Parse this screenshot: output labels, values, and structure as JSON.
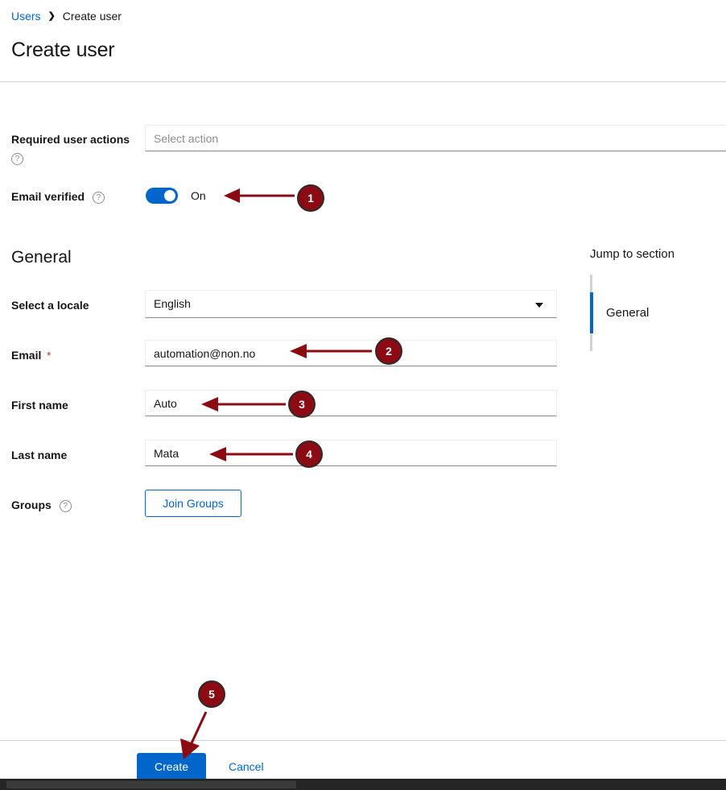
{
  "breadcrumb": {
    "parent": "Users",
    "separator": "❯",
    "current": "Create user"
  },
  "page": {
    "title": "Create user"
  },
  "form": {
    "required_user_actions": {
      "label": "Required user actions",
      "help_icon": "help-circle-icon",
      "placeholder": "Select action",
      "value": ""
    },
    "email_verified": {
      "label": "Email verified",
      "help_icon": "help-circle-icon",
      "state": "On",
      "on": true
    },
    "section_general": {
      "heading": "General",
      "locale": {
        "label": "Select a locale",
        "value": "English",
        "caret_icon": "chevron-down-icon"
      },
      "email": {
        "label": "Email",
        "required_marker": "*",
        "value": "automation@non.no",
        "placeholder": ""
      },
      "first_name": {
        "label": "First name",
        "value": "Auto",
        "placeholder": ""
      },
      "last_name": {
        "label": "Last name",
        "value": "Mata",
        "placeholder": ""
      },
      "groups": {
        "label": "Groups",
        "help_icon": "help-circle-icon",
        "join_button": "Join Groups"
      }
    }
  },
  "jump_to_section": {
    "title": "Jump to section",
    "items": [
      {
        "label": "General",
        "active": true
      }
    ]
  },
  "footer": {
    "create_label": "Create",
    "cancel_label": "Cancel"
  },
  "annotations": [
    {
      "number": "1",
      "target": "email-verified-toggle"
    },
    {
      "number": "2",
      "target": "email-input"
    },
    {
      "number": "3",
      "target": "first-name-input"
    },
    {
      "number": "4",
      "target": "last-name-input"
    },
    {
      "number": "5",
      "target": "create-button"
    }
  ],
  "colors": {
    "link": "#0066cc",
    "primary": "#0066cc",
    "required": "#c9190b",
    "annotation": "#8c0b12",
    "divider": "#d2d2d2",
    "muted": "#8a8d90"
  }
}
